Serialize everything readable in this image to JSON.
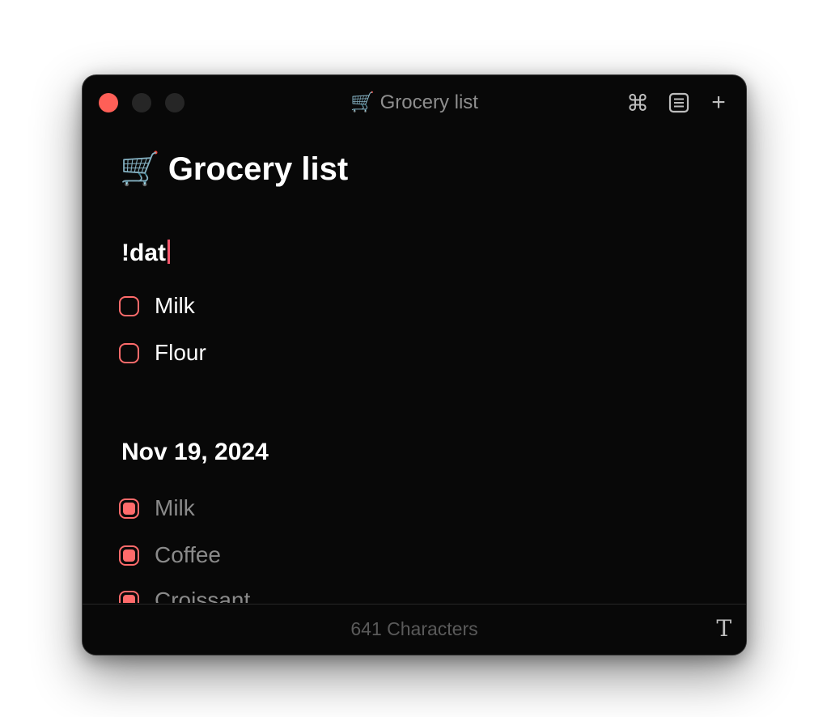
{
  "window": {
    "title": "🛒 Grocery list"
  },
  "toolbar": {
    "command_icon": "⌘",
    "list_icon": "list-icon",
    "plus_icon": "+"
  },
  "document": {
    "title_emoji": "🛒",
    "title_text": "Grocery list",
    "sections": [
      {
        "heading": "!dat",
        "items": [
          {
            "label": "Milk",
            "checked": false
          },
          {
            "label": "Flour",
            "checked": false
          }
        ]
      },
      {
        "heading": "Nov 19, 2024",
        "items": [
          {
            "label": "Milk",
            "checked": true
          },
          {
            "label": "Coffee",
            "checked": true
          },
          {
            "label": "Croissant",
            "checked": true
          }
        ]
      }
    ]
  },
  "footer": {
    "char_count": "641 Characters",
    "format_icon": "T"
  },
  "colors": {
    "accent": "#ff6b6b",
    "caret": "#f4566b",
    "background": "#080808"
  }
}
